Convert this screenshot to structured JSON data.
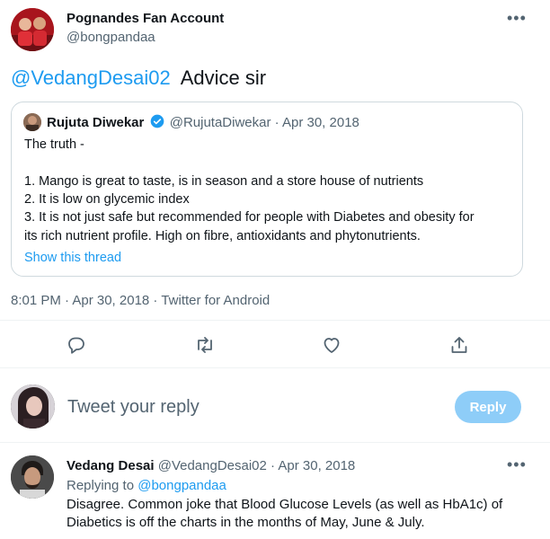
{
  "tweet": {
    "display_name": "Pognandes Fan Account",
    "handle": "@bongpandaa",
    "mention": "@VedangDesai02",
    "text": "Advice sir",
    "timestamp": "8:01 PM · Apr 30, 2018 · Twitter for Android"
  },
  "quoted": {
    "display_name": "Rujuta Diwekar",
    "handle_date": "@RujutaDiwekar · Apr 30, 2018",
    "lines": [
      "The truth -",
      "",
      "1. Mango is great to taste, is in season and a store house of nutrients",
      "2. It is low on glycemic index",
      "3. It is not just safe but recommended for people with Diabetes and obesity for",
      "its rich nutrient profile. High on fibre, antioxidants and  phytonutrients."
    ],
    "show_thread": "Show this thread"
  },
  "actions": {
    "icons": [
      "reply-icon",
      "retweet-icon",
      "like-icon",
      "share-icon"
    ]
  },
  "composer": {
    "placeholder": "Tweet your reply",
    "button_label": "Reply"
  },
  "reply": {
    "display_name": "Vedang Desai",
    "handle_date": "@VedangDesai02 · Apr 30, 2018",
    "replying_to_prefix": "Replying to",
    "replying_to_handle": "@bongpandaa",
    "lines": [
      "Disagree. Common joke that Blood Glucose Levels (as well as HbA1c) of",
      "Diabetics is off the charts in the months of May, June & July."
    ]
  },
  "colors": {
    "accent": "#1d9bf0",
    "reply_button": "#8ecdf8",
    "muted": "#536471",
    "border": "#cfd9de"
  }
}
